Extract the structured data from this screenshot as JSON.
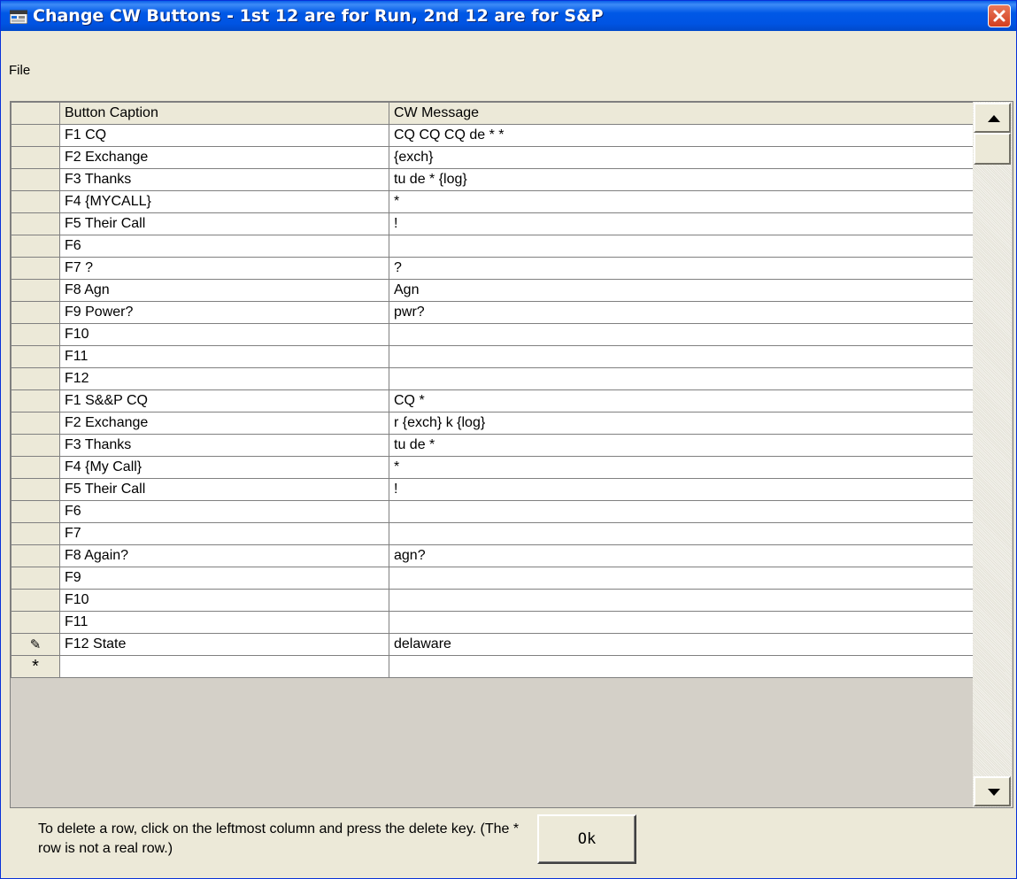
{
  "window": {
    "title": "Change CW Buttons - 1st 12 are for Run, 2nd 12 are for S&P"
  },
  "menu": {
    "file": "File"
  },
  "grid": {
    "headers": {
      "caption": "Button Caption",
      "message": "CW Message"
    },
    "rows": [
      {
        "caption": "F1  CQ",
        "message": "CQ CQ CQ de * *"
      },
      {
        "caption": "F2  Exchange",
        "message": "{exch}"
      },
      {
        "caption": "F3  Thanks",
        "message": "tu de * {log}"
      },
      {
        "caption": "F4  {MYCALL}",
        "message": "*"
      },
      {
        "caption": "F5  Their Call",
        "message": "!"
      },
      {
        "caption": "F6",
        "message": ""
      },
      {
        "caption": "F7  ?",
        "message": "?"
      },
      {
        "caption": "F8  Agn",
        "message": "Agn"
      },
      {
        "caption": "F9  Power?",
        "message": "pwr?"
      },
      {
        "caption": "F10",
        "message": ""
      },
      {
        "caption": "F11",
        "message": ""
      },
      {
        "caption": "F12",
        "message": ""
      },
      {
        "caption": "F1 S&&P CQ",
        "message": "CQ *"
      },
      {
        "caption": "F2   Exchange",
        "message": "r {exch} k {log}"
      },
      {
        "caption": "F3  Thanks",
        "message": "tu de *"
      },
      {
        "caption": "F4  {My Call}",
        "message": "*"
      },
      {
        "caption": "F5  Their Call",
        "message": "!"
      },
      {
        "caption": "F6",
        "message": ""
      },
      {
        "caption": "F7",
        "message": ""
      },
      {
        "caption": "F8  Again?",
        "message": "agn?"
      },
      {
        "caption": "F9",
        "message": ""
      },
      {
        "caption": "F10",
        "message": ""
      },
      {
        "caption": "F11",
        "message": ""
      },
      {
        "caption": "F12 State",
        "message": "delaware"
      }
    ],
    "new_row_marker": "*"
  },
  "footer": {
    "hint": "To delete a row, click on the leftmost column and press the delete key. (The * row is not a real row.)",
    "ok_label": "Ok"
  },
  "icons": {
    "title": "window-app-icon",
    "close": "close-icon",
    "edit": "pencil-icon"
  },
  "colors": {
    "titlebar": "#0054e3",
    "close": "#d23e1e",
    "face": "#ece9d8"
  }
}
